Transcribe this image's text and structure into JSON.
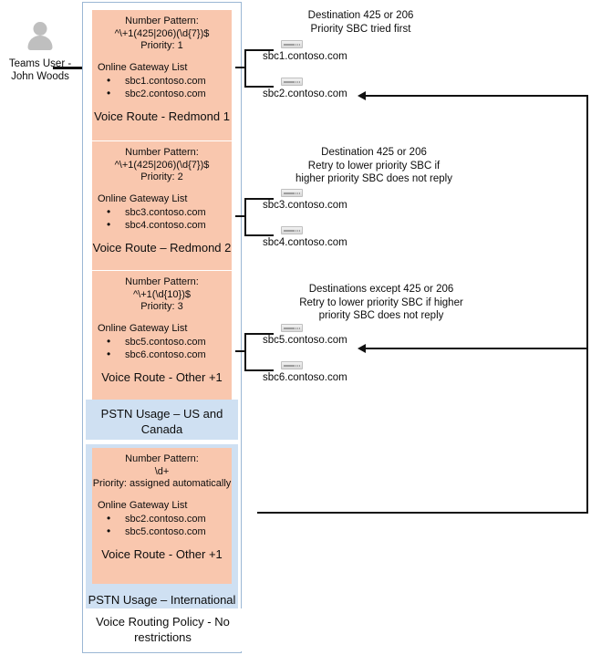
{
  "user": {
    "icon": "person-avatar-icon",
    "label": "Teams User -\nJohn Woods"
  },
  "policy": {
    "label": "Voice Routing Policy -\nNo restrictions",
    "usages": [
      {
        "label": "PSTN Usage –\nUS and Canada"
      },
      {
        "label": "PSTN Usage –\nInternational"
      }
    ],
    "routes": [
      {
        "pattern_label": "Number Pattern:",
        "pattern": "^\\+1(425|206)(\\d{7})$",
        "priority": "Priority: 1",
        "gateway_title": "Online Gateway List",
        "gateways": [
          "sbc1.contoso.com",
          "sbc2.contoso.com"
        ],
        "name": "Voice Route -\nRedmond 1"
      },
      {
        "pattern_label": "Number Pattern:",
        "pattern": "^\\+1(425|206)(\\d{7})$",
        "priority": "Priority: 2",
        "gateway_title": "Online Gateway List",
        "gateways": [
          "sbc3.contoso.com",
          "sbc4.contoso.com"
        ],
        "name": "Voice Route –\nRedmond 2"
      },
      {
        "pattern_label": "Number Pattern:",
        "pattern": "^\\+1(\\d{10})$",
        "priority": "Priority: 3",
        "gateway_title": "Online Gateway List",
        "gateways": [
          "sbc5.contoso.com",
          "sbc6.contoso.com"
        ],
        "name": "Voice Route -\nOther +1"
      },
      {
        "pattern_label": "Number Pattern:",
        "pattern": "\\d+",
        "priority": "Priority: assigned\nautomatically",
        "gateway_title": "Online Gateway List",
        "gateways": [
          "sbc2.contoso.com",
          "sbc5.contoso.com"
        ],
        "name": "Voice Route -\nOther +1"
      }
    ]
  },
  "annotations": [
    {
      "text": "Destination 425 or 206\nPriority SBC tried first"
    },
    {
      "text": "Destination 425 or 206\nRetry to lower priority SBC if\nhigher priority SBC does not reply"
    },
    {
      "text": "Destinations except 425 or 206\nRetry to lower priority SBC if higher\npriority SBC does not reply"
    }
  ],
  "sbcs": [
    {
      "name": "sbc1.contoso.com",
      "icon": "sbc-device-icon"
    },
    {
      "name": "sbc2.contoso.com",
      "icon": "sbc-device-icon"
    },
    {
      "name": "sbc3.contoso.com",
      "icon": "sbc-device-icon"
    },
    {
      "name": "sbc4.contoso.com",
      "icon": "sbc-device-icon"
    },
    {
      "name": "sbc5.contoso.com",
      "icon": "sbc-device-icon"
    },
    {
      "name": "sbc6.contoso.com",
      "icon": "sbc-device-icon"
    }
  ],
  "colors": {
    "route_fill": "#f9c7ae",
    "usage_fill": "#cfe0f2",
    "container_border": "#9bb7d4",
    "connector": "#111111"
  }
}
